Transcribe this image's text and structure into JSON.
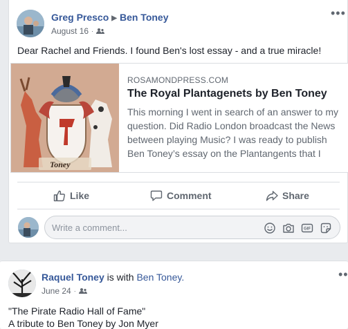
{
  "post1": {
    "author": "Greg Presco",
    "target": "Ben Toney",
    "date": "August 16",
    "audience_icon": "friends-icon",
    "text": "Dear Rachel and Friends. I found Ben's lost essay - and a true miracle!",
    "link": {
      "domain": "ROSAMONDPRESS.COM",
      "title": "The Royal Plantagenets by Ben Toney",
      "description": "This morning I went in search of an answer to my question. Did Radio London broadcast the News between playing Music? I was ready to publish Ben Toney’s essay on the Plantangents that I",
      "thumb_caption": "Toney"
    },
    "actions": {
      "like": "Like",
      "comment": "Comment",
      "share": "Share"
    },
    "comment_placeholder": "Write a comment...",
    "more_icon": "•••"
  },
  "post2": {
    "author": "Raquel Toney",
    "with_text": "is with",
    "with_name": "Ben Toney.",
    "date": "June 24",
    "more_icon": "••",
    "line1": "\"The Pirate Radio Hall of Fame\"",
    "line2": "A tribute to Ben Toney by Jon Myer"
  },
  "colors": {
    "link_blue": "#365899",
    "meta_gray": "#616770",
    "background": "#e9ebee"
  }
}
